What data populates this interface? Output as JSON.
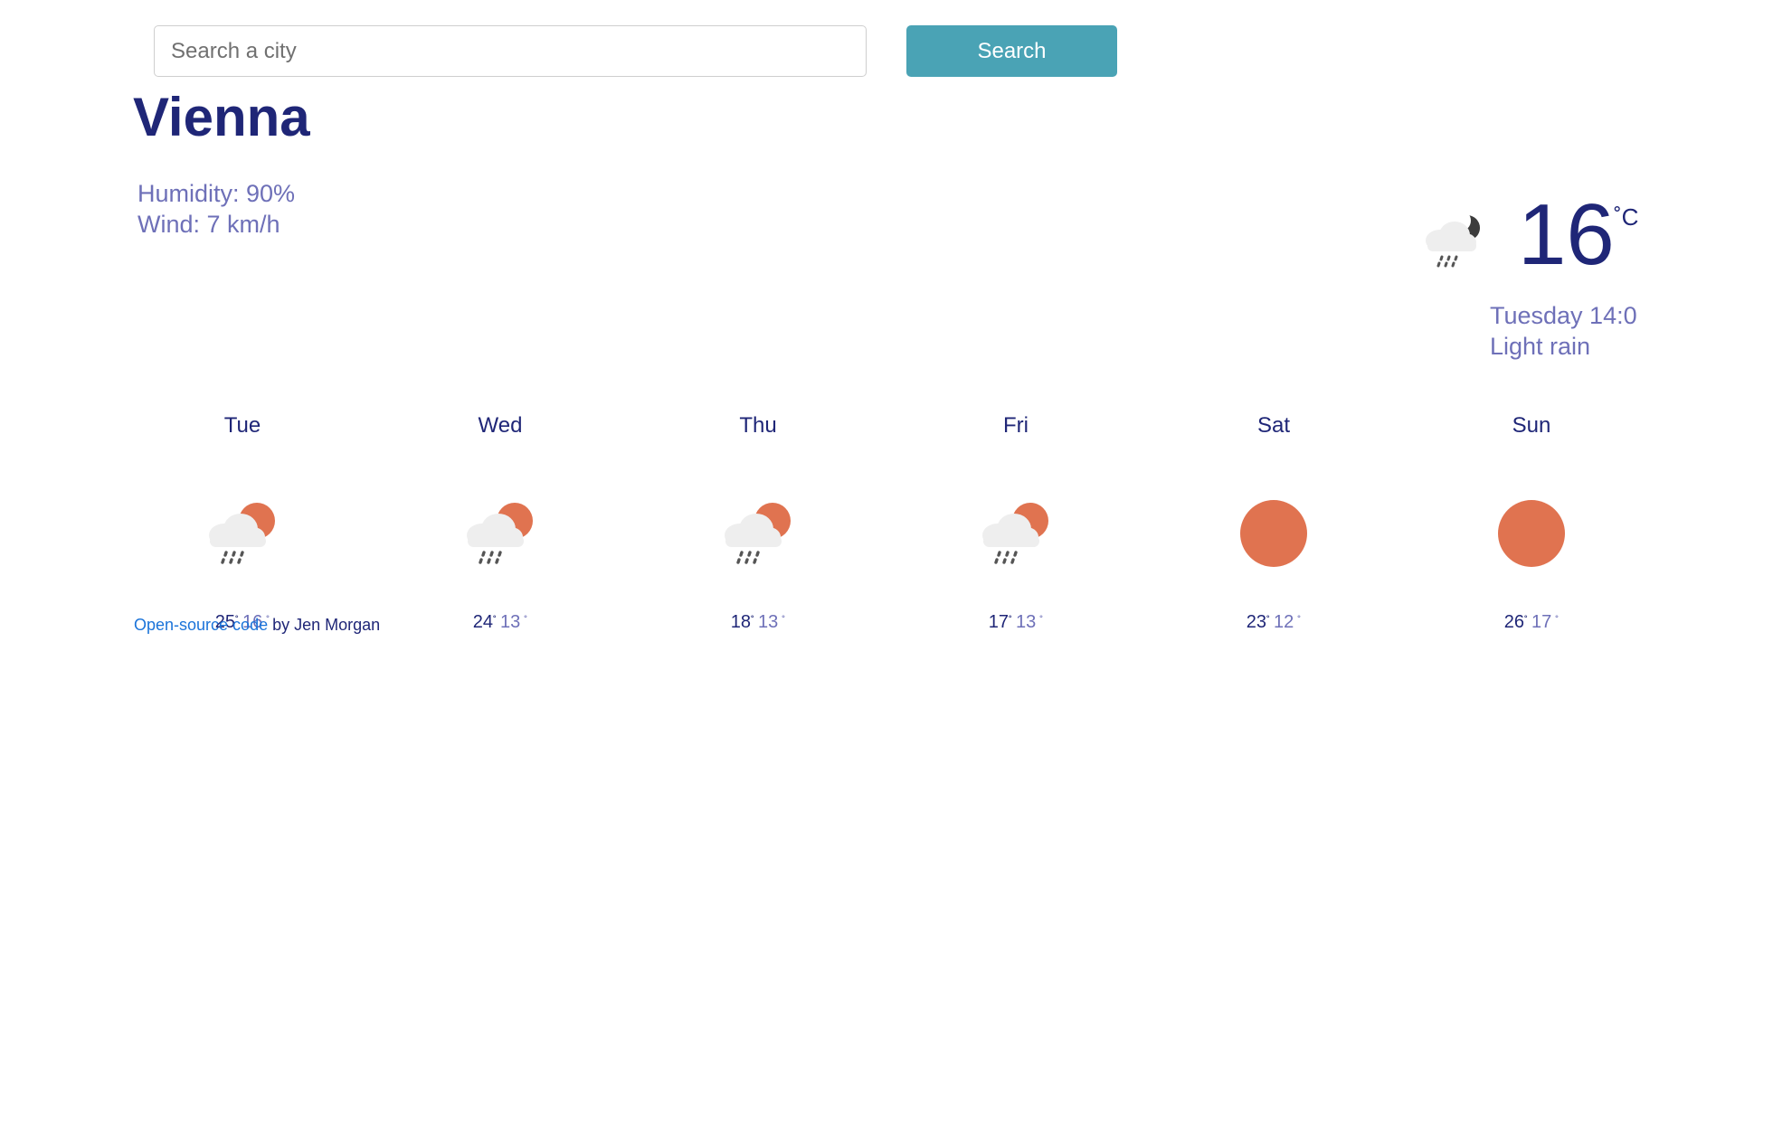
{
  "search": {
    "placeholder": "Search a city",
    "button_label": "Search"
  },
  "current": {
    "city": "Vienna",
    "humidity_text": "Humidity: 90%",
    "wind_text": "Wind: 7 km/h",
    "temperature": "16",
    "unit": "˚C",
    "datetime": "Tuesday 14:0",
    "description": "Light rain",
    "icon": "rain-night-icon"
  },
  "forecast": [
    {
      "day": "Tue",
      "max": "25",
      "min": "16",
      "icon": "rain-sun-icon"
    },
    {
      "day": "Wed",
      "max": "24",
      "min": "13",
      "icon": "rain-sun-icon"
    },
    {
      "day": "Thu",
      "max": "18",
      "min": "13",
      "icon": "rain-sun-icon"
    },
    {
      "day": "Fri",
      "max": "17",
      "min": "13",
      "icon": "rain-sun-icon"
    },
    {
      "day": "Sat",
      "max": "23",
      "min": "12",
      "icon": "sun-icon"
    },
    {
      "day": "Sun",
      "max": "26",
      "min": "17",
      "icon": "sun-icon"
    }
  ],
  "degree_symbol": "˚",
  "footer": {
    "link_text": "Open-source code",
    "suffix": " by Jen Morgan"
  },
  "colors": {
    "accent": "#4aa3b5",
    "title": "#1f2677",
    "secondary": "#6e70b8",
    "sun": "#e07350",
    "link": "#1a73d9"
  }
}
